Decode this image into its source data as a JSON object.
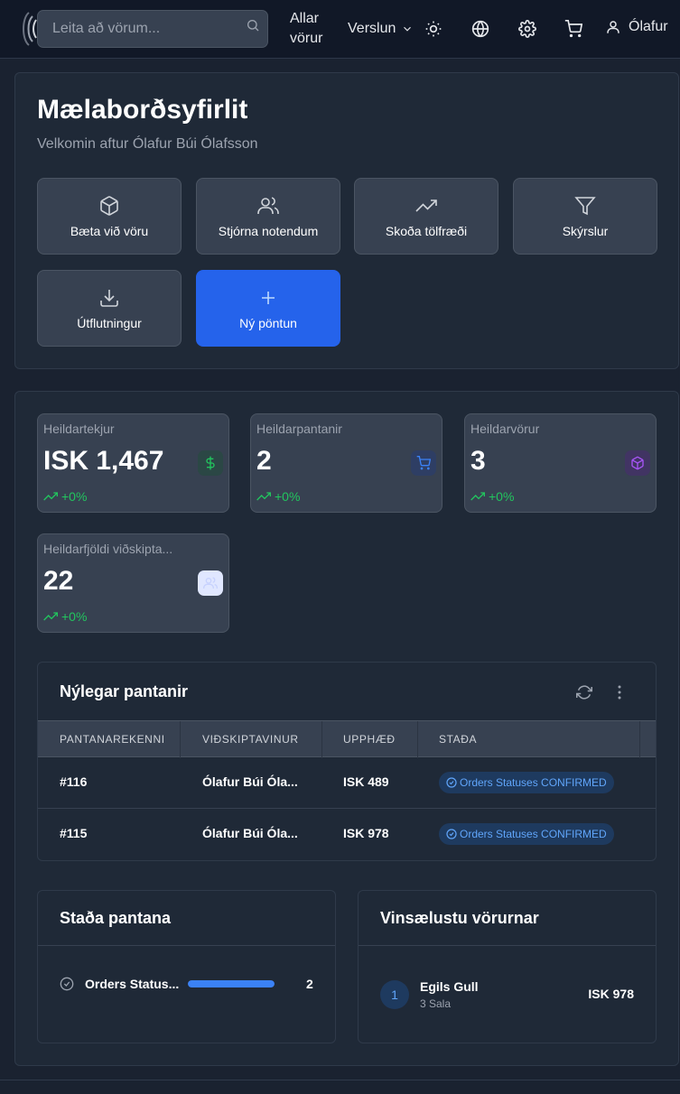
{
  "navbar": {
    "search_placeholder": "Leita að vörum...",
    "all_products": "Allar vörur",
    "shop": "Verslun",
    "user_name": "Ólafur"
  },
  "dashboard": {
    "title": "Mælaborðsyfirlit",
    "welcome": "Velkomin aftur Ólafur Búi Ólafsson",
    "actions": [
      {
        "label": "Bæta við vöru",
        "icon": "package-icon"
      },
      {
        "label": "Stjórna notendum",
        "icon": "users-icon"
      },
      {
        "label": "Skoða tölfræði",
        "icon": "trending-up-icon"
      },
      {
        "label": "Skýrslur",
        "icon": "filter-icon"
      },
      {
        "label": "Útflutningur",
        "icon": "download-icon"
      },
      {
        "label": "Ný pöntun",
        "icon": "plus-icon"
      }
    ]
  },
  "stats": [
    {
      "label": "Heildartekjur",
      "value": "ISK 1,467",
      "trend": "+0%",
      "icon": "dollar-icon",
      "color": "#22c55e"
    },
    {
      "label": "Heildarpantanir",
      "value": "2",
      "trend": "+0%",
      "icon": "cart-icon",
      "color": "#3b82f6"
    },
    {
      "label": "Heildarvörur",
      "value": "3",
      "trend": "+0%",
      "icon": "package-icon",
      "color": "#a855f7"
    },
    {
      "label": "Heildarfjöldi viðskipta...",
      "value": "22",
      "trend": "+0%",
      "icon": "users-icon",
      "color": "#e0e7ff"
    }
  ],
  "orders": {
    "title": "Nýlegar pantanir",
    "columns": [
      "PANTANAREKENNI",
      "VIÐSKIPTAVINUR",
      "UPPHÆÐ",
      "STAÐA"
    ],
    "rows": [
      {
        "id": "#116",
        "customer": "Ólafur Búi Óla...",
        "amount": "ISK 489",
        "status": "Orders Statuses CONFIRMED"
      },
      {
        "id": "#115",
        "customer": "Ólafur Búi Óla...",
        "amount": "ISK 978",
        "status": "Orders Statuses CONFIRMED"
      }
    ]
  },
  "order_status": {
    "title": "Staða pantana",
    "items": [
      {
        "label": "Orders Status...",
        "count": "2",
        "fraction": 1.0
      }
    ]
  },
  "popular": {
    "title": "Vinsælustu vörurnar",
    "items": [
      {
        "rank": "1",
        "name": "Egils Gull",
        "sales": "3 Sala",
        "price": "ISK 978"
      }
    ]
  },
  "colors": {
    "accent": "#2563eb",
    "success": "#22c55e",
    "status_pill": "#60a5fa"
  }
}
